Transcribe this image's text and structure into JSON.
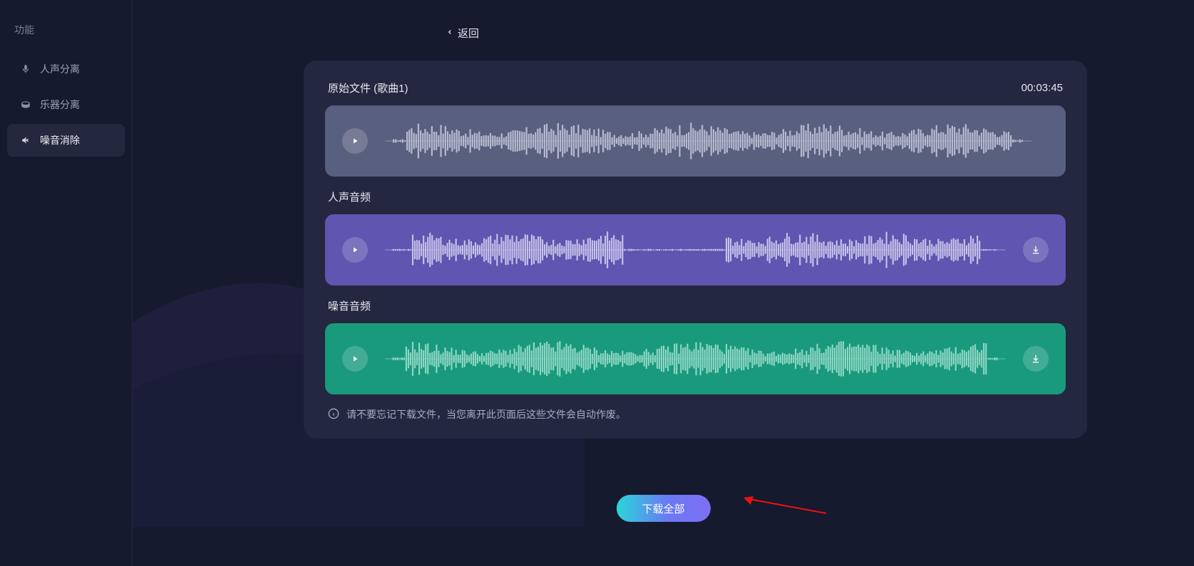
{
  "sidebar": {
    "title": "功能",
    "items": [
      {
        "label": "人声分离",
        "icon": "mic-icon"
      },
      {
        "label": "乐器分离",
        "icon": "drum-icon"
      },
      {
        "label": "噪音消除",
        "icon": "speaker-mute-icon"
      }
    ]
  },
  "back_label": "返回",
  "tracks": {
    "original": {
      "title": "原始文件 (歌曲1)",
      "duration": "00:03:45"
    },
    "vocal": {
      "title": "人声音频"
    },
    "noise": {
      "title": "噪音音频"
    }
  },
  "info_text": "请不要忘记下载文件，当您离开此页面后这些文件会自动作废。",
  "download_all_label": "下载全部"
}
